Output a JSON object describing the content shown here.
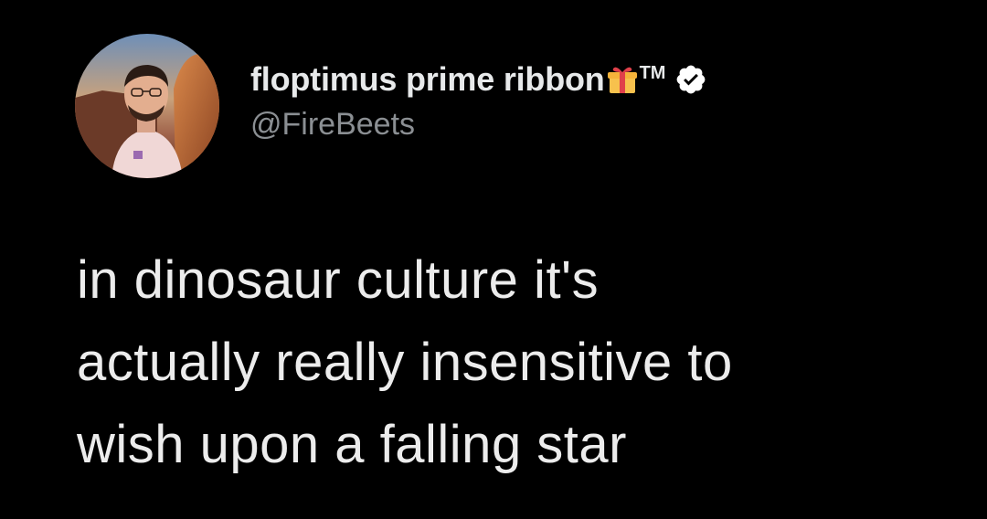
{
  "tweet": {
    "display_name": "floptimus prime ribbon",
    "trademark": "TM",
    "handle": "@FireBeets",
    "text_lines": [
      "in dinosaur culture it's",
      "actually really insensitive to",
      "wish upon a falling star"
    ],
    "icons": {
      "avatar": "profile-photo",
      "gift": "gift-icon",
      "verified": "verified-badge-icon"
    },
    "colors": {
      "background": "#000000",
      "text": "#e7e9ea",
      "handle": "#8b8f93",
      "gift_box": "#f7c14d",
      "gift_ribbon": "#e0404a"
    }
  }
}
